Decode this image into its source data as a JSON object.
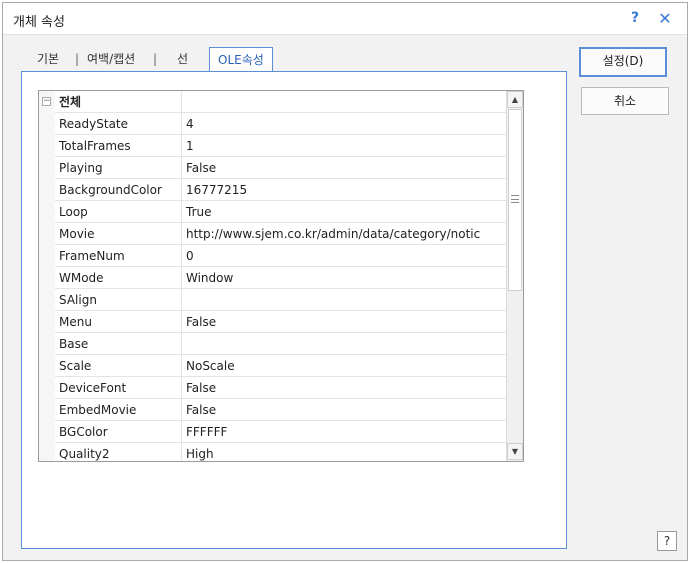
{
  "window": {
    "title": "개체 속성",
    "help_glyph": "?",
    "close_glyph": "✕"
  },
  "tabs": [
    {
      "label": "기본",
      "active": false
    },
    {
      "label": "여백/캡션",
      "active": false
    },
    {
      "label": "선",
      "active": false
    },
    {
      "label": "OLE속성",
      "active": true
    }
  ],
  "tab_separator": "|",
  "grid": {
    "group_label": "전체",
    "collapse_glyph": "−",
    "rows": [
      {
        "name": "ReadyState",
        "value": "4"
      },
      {
        "name": "TotalFrames",
        "value": "1"
      },
      {
        "name": "Playing",
        "value": "False"
      },
      {
        "name": "BackgroundColor",
        "value": "16777215"
      },
      {
        "name": "Loop",
        "value": "True"
      },
      {
        "name": "Movie",
        "value": "http://www.sjem.co.kr/admin/data/category/notic"
      },
      {
        "name": "FrameNum",
        "value": "0"
      },
      {
        "name": "WMode",
        "value": "Window"
      },
      {
        "name": "SAlign",
        "value": ""
      },
      {
        "name": "Menu",
        "value": "False"
      },
      {
        "name": "Base",
        "value": ""
      },
      {
        "name": "Scale",
        "value": "NoScale"
      },
      {
        "name": "DeviceFont",
        "value": "False"
      },
      {
        "name": "EmbedMovie",
        "value": "False"
      },
      {
        "name": "BGColor",
        "value": "FFFFFF"
      },
      {
        "name": "Quality2",
        "value": "High"
      }
    ],
    "scroll_up_glyph": "▲",
    "scroll_down_glyph": "▼"
  },
  "buttons": {
    "ok_label": "설정(D)",
    "cancel_label": "취소",
    "help_label": "?"
  },
  "colors": {
    "accent": "#5b8ed6",
    "title_icon": "#3a7bd5"
  }
}
